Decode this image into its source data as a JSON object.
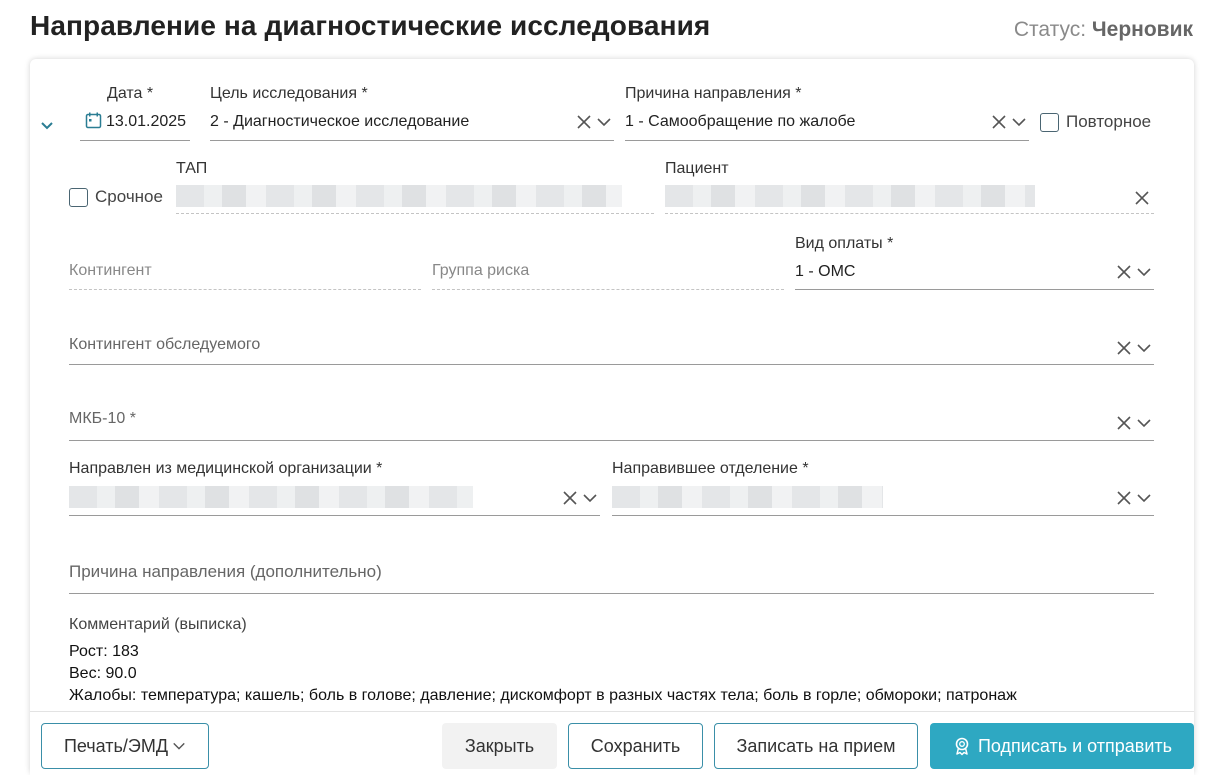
{
  "header": {
    "title": "Направление на диагностические исследования",
    "status_label": "Статус:",
    "status_value": "Черновик"
  },
  "form": {
    "date": {
      "label": "Дата *",
      "value": "13.01.2025"
    },
    "goal": {
      "label": "Цель исследования *",
      "value": "2 - Диагностическое исследование"
    },
    "reason": {
      "label": "Причина направления *",
      "value": "1 - Самообращение по жалобе"
    },
    "repeat": {
      "label": "Повторное"
    },
    "urgent": {
      "label": "Срочное"
    },
    "tap": {
      "label": "ТАП"
    },
    "patient": {
      "label": "Пациент"
    },
    "contingent": {
      "label": "Контингент"
    },
    "risk_group": {
      "label": "Группа риска"
    },
    "payment": {
      "label": "Вид оплаты *",
      "value": "1 - ОМС"
    },
    "examined_contingent": {
      "label": "Контингент обследуемого"
    },
    "mkb": {
      "label": "МКБ-10 *"
    },
    "from_org": {
      "label": "Направлен из медицинской организации *"
    },
    "department": {
      "label": "Направившее отделение *"
    },
    "reason_extra": {
      "label": "Причина направления (дополнительно)"
    },
    "comment": {
      "label": "Комментарий (выписка)",
      "lines": [
        "Рост: 183",
        "Вес: 90.0",
        "Жалобы: температура; кашель; боль в голове; давление; дискомфорт в разных частях тела; боль в горле; обмороки; патронаж"
      ]
    }
  },
  "footer": {
    "print": "Печать/ЭМД",
    "close": "Закрыть",
    "save": "Сохранить",
    "appoint": "Записать на прием",
    "sign": "Подписать и отправить"
  },
  "colors": {
    "accent": "#2ea8c2",
    "outline": "#3a8fa8"
  }
}
